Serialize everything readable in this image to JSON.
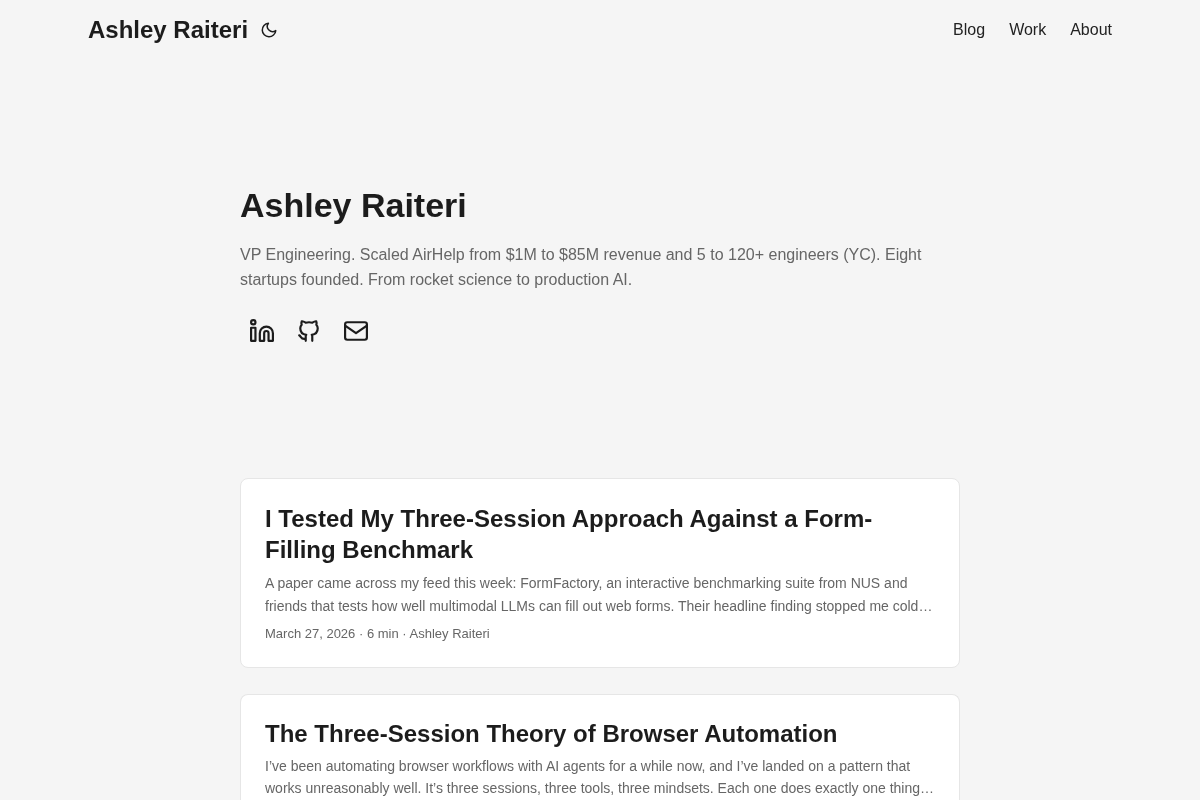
{
  "header": {
    "brand": "Ashley Raiteri",
    "nav": [
      "Blog",
      "Work",
      "About"
    ]
  },
  "hero": {
    "title": "Ashley Raiteri",
    "bio": "VP Engineering. Scaled AirHelp from $1M to $85M revenue and 5 to 120+ engineers (YC). Eight startups founded. From rocket science to production AI.",
    "social_links": [
      {
        "kind": "linkedin"
      },
      {
        "kind": "github"
      },
      {
        "kind": "email"
      }
    ]
  },
  "posts": [
    {
      "title": "I Tested My Three-Session Approach Against a Form-Filling Benchmark",
      "excerpt": "A paper came across my feed this week: FormFactory, an interactive benchmarking suite from NUS and friends that tests how well multimodal LLMs can fill out web forms. Their headline finding stopped me cold…",
      "meta": "March 27, 2026 · 6 min · Ashley Raiteri"
    },
    {
      "title": "The Three-Session Theory of Browser Automation",
      "excerpt": "I’ve been automating browser workflows with AI agents for a while now, and I’ve landed on a pattern that works unreasonably well. It’s three sessions, three tools, three mindsets. Each one does exactly one thing…"
    }
  ]
}
